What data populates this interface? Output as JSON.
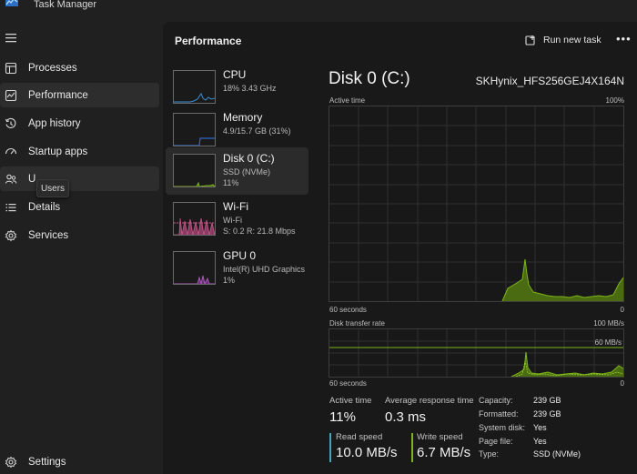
{
  "app": {
    "title": "Task Manager"
  },
  "nav": {
    "items": [
      {
        "label": "Processes",
        "icon": "processes-icon"
      },
      {
        "label": "Performance",
        "icon": "performance-icon"
      },
      {
        "label": "App history",
        "icon": "history-icon"
      },
      {
        "label": "Startup apps",
        "icon": "startup-icon"
      },
      {
        "label": "Users",
        "display_label": "U",
        "icon": "users-icon"
      },
      {
        "label": "Details",
        "icon": "details-icon"
      },
      {
        "label": "Services",
        "icon": "services-icon"
      }
    ],
    "settings_label": "Settings",
    "tooltip": "Users"
  },
  "header": {
    "title": "Performance",
    "run_task_label": "Run new task",
    "more_label": "•••"
  },
  "devices": [
    {
      "name": "CPU",
      "sub1": "18%  3.43 GHz",
      "sub2": "",
      "color": "#3b8ed6"
    },
    {
      "name": "Memory",
      "sub1": "4.9/15.7 GB (31%)",
      "sub2": "",
      "color": "#2f68c4"
    },
    {
      "name": "Disk 0 (C:)",
      "sub1": "SSD (NVMe)",
      "sub2": "11%",
      "color": "#7cb518"
    },
    {
      "name": "Wi-Fi",
      "sub1": "Wi-Fi",
      "sub2": "S: 0.2  R: 21.8 Mbps",
      "color": "#c55a8a"
    },
    {
      "name": "GPU 0",
      "sub1": "Intel(R) UHD Graphics",
      "sub2": "1%",
      "color": "#b05cc0"
    }
  ],
  "detail": {
    "title": "Disk 0 (C:)",
    "model": "SKHynix_HFS256GEJ4X164N",
    "active_time_graph": {
      "label": "Active time",
      "max_label": "100%",
      "time_label": "60 seconds",
      "min_label": "0"
    },
    "transfer_graph": {
      "label": "Disk transfer rate",
      "max_label": "100 MB/s",
      "mid_label": "60 MB/s",
      "time_label": "60 seconds",
      "min_label": "0"
    },
    "stats": {
      "active_time_label": "Active time",
      "active_time_value": "11%",
      "avg_response_label": "Average response time",
      "avg_response_value": "0.3 ms",
      "read_label": "Read speed",
      "read_value": "10.0 MB/s",
      "write_label": "Write speed",
      "write_value": "6.7 MB/s"
    },
    "properties": [
      {
        "key": "Capacity:",
        "value": "239 GB"
      },
      {
        "key": "Formatted:",
        "value": "239 GB"
      },
      {
        "key": "System disk:",
        "value": "Yes"
      },
      {
        "key": "Page file:",
        "value": "Yes"
      },
      {
        "key": "Type:",
        "value": "SSD (NVMe)"
      }
    ]
  },
  "colors": {
    "disk_green": "#7cb518",
    "disk_fill": "#4a6b12",
    "read_accent": "#4aa3b5",
    "write_accent": "#7cb518"
  }
}
